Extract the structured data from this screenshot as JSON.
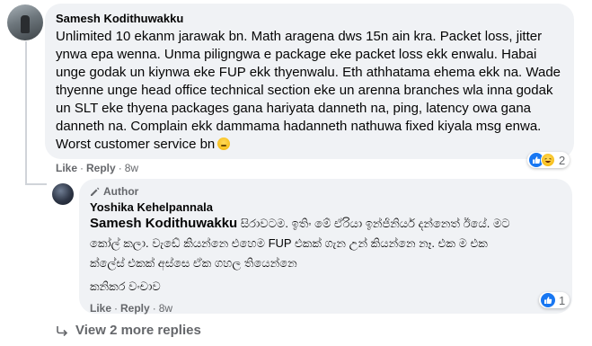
{
  "comment": {
    "author": "Samesh Kodithuwakku",
    "lines": [
      "Unlimited 10 ekanm jarawak bn. Math aragena dws 15n ain kra. Packet loss, jitter",
      "ynwa epa wenna. Unma piligngwa e package eke packet loss ekk enwalu. Habai",
      "unge godak un kiynwa eke FUP ekk thyenwalu. Eth athhatama ehema ekk na. Wade",
      "thyenne unge head office technical section eke un arenna branches wla inna godak",
      "un SLT eke thyena packages gana hariyata danneth na, ping, latency owa gana",
      "danneth na. Complain ekk dammama hadanneth nathuwa fixed kiyala msg enwa.",
      "Worst customer service bn"
    ],
    "actions": {
      "like": "Like",
      "reply": "Reply",
      "time": "8w"
    },
    "reaction_count": "2",
    "reaction_icons": [
      "like-icon",
      "haha-icon"
    ]
  },
  "reply": {
    "badge": "Author",
    "author": "Yoshika Kehelpannala",
    "mention": "Samesh Kodithuwakku",
    "line1_rest": " සිරාවටම. ඉතිං මේ ඒරියා ඉන්ජිනියර් දන්නෙත් ඊයේ. මට",
    "line2": "කෝල් කලා. වැඩේ කියන්නෙ එහෙම FUP එකක් ගැන උන් කියන්නෙ නෑ. එක ම එක",
    "line3": "ක්ලේස් එකක් අස්සෙ ඒක ගහල තියෙන්නෙ",
    "line4": "කනිකර වංචාව",
    "actions": {
      "like": "Like",
      "reply": "Reply",
      "time": "8w"
    },
    "reaction_count": "1"
  },
  "view_more": "View 2 more replies",
  "colors": {
    "bubble": "#f0f2f5",
    "like_blue": "#1877f2",
    "secondary_text": "#65676b"
  }
}
